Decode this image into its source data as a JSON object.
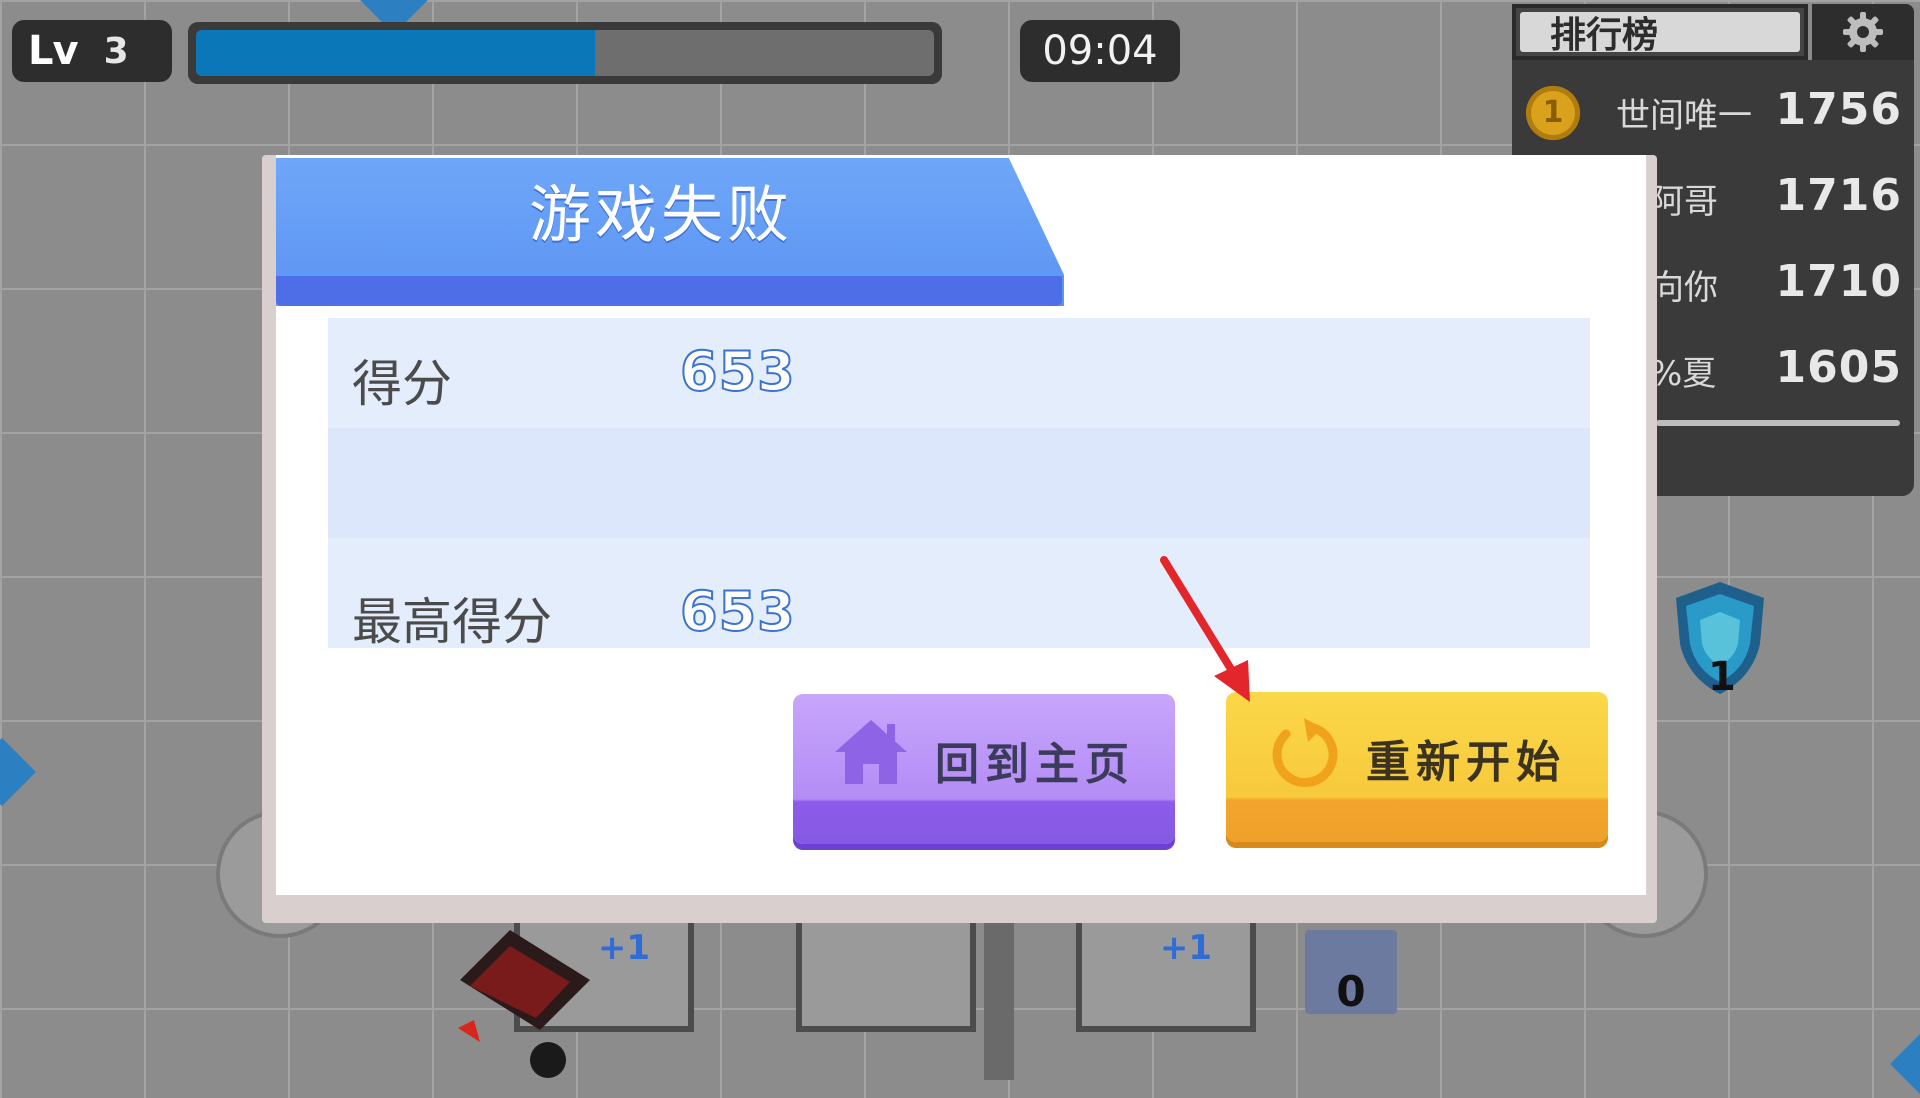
{
  "hud": {
    "level_label": "Lv",
    "level_value": "3",
    "xp_fraction": 0.54,
    "timer": "09:04"
  },
  "leaderboard": {
    "title": "排行榜",
    "entries": [
      {
        "rank": "1",
        "name": "世间唯一",
        "score": "1756"
      },
      {
        "rank": "",
        "name": "大阿哥",
        "score": "1716"
      },
      {
        "rank": "",
        "name": "走向你",
        "score": "1710"
      },
      {
        "rank": "",
        "name": "平%夏",
        "score": "1605"
      }
    ]
  },
  "shield_count": "1",
  "slot_bonus": "+1",
  "counter_value": "0",
  "modal": {
    "title": "游戏失败",
    "score_label": "得分",
    "score_value": "653",
    "best_label": "最高得分",
    "best_value": "653",
    "home_button": "回到主页",
    "restart_button": "重新开始"
  },
  "colors": {
    "title_blue": "#5b93f3",
    "home_purple": "#b48cf6",
    "restart_yellow": "#f7c93c",
    "annotation_red": "#e3262b"
  }
}
